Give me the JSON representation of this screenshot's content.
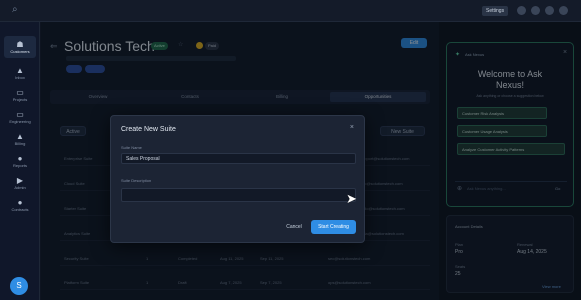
{
  "topbar": {
    "pill_label": "Settings"
  },
  "sidebar": {
    "items": [
      {
        "label": "Customers",
        "icon": "users-icon",
        "glyph": "☗"
      },
      {
        "label": "Inbox",
        "icon": "inbox-icon",
        "glyph": "▲"
      },
      {
        "label": "Projects",
        "icon": "projects-icon",
        "glyph": "▭"
      },
      {
        "label": "Engineering",
        "icon": "code-icon",
        "glyph": "▭"
      },
      {
        "label": "Billing",
        "icon": "billing-icon",
        "glyph": "▲"
      },
      {
        "label": "Reports",
        "icon": "reports-icon",
        "glyph": "●"
      },
      {
        "label": "Admin",
        "icon": "admin-icon",
        "glyph": "▶"
      },
      {
        "label": "Contracts",
        "icon": "contracts-icon",
        "glyph": "●"
      }
    ],
    "avatar_initial": "S"
  },
  "header": {
    "title": "Solutions Tech",
    "status_badge": "Active",
    "extra_badge": "Paid",
    "edit_label": "Edit"
  },
  "tabs": [
    "Overview",
    "Contacts",
    "Billing",
    "Opportunities"
  ],
  "table": {
    "filter_label": "Active",
    "new_button": "New Suite",
    "rows": [
      {
        "name": "Enterprise Suite",
        "col2": "",
        "col3": "",
        "col4": "",
        "col5": "",
        "email": "support@solutionstech.com"
      },
      {
        "name": "Cloud Suite",
        "col2": "",
        "col3": "",
        "col4": "",
        "col5": "",
        "email": "info@solutionstech.com"
      },
      {
        "name": "Starter Suite",
        "col2": "",
        "col3": "",
        "col4": "",
        "col5": "",
        "email": "hello@solutionstech.com"
      },
      {
        "name": "Analytics Suite",
        "col2": "",
        "col3": "",
        "col4": "",
        "col5": "",
        "email": "data@solutionstech.com"
      },
      {
        "name": "Security Suite",
        "col2": "1",
        "col3": "Completed",
        "col4": "Aug 11, 2025",
        "col5": "Sep 11, 2025",
        "email": "sec@solutionstech.com"
      },
      {
        "name": "Platform Suite",
        "col2": "1",
        "col3": "Draft",
        "col4": "Aug 7, 2025",
        "col5": "Sep 7, 2025",
        "email": "ops@solutionstech.com"
      }
    ]
  },
  "modal": {
    "title": "Create New Suite",
    "name_label": "Suite Name",
    "name_value": "Sales Proposal",
    "desc_label": "Suite Description",
    "desc_value": "",
    "cancel_label": "Cancel",
    "create_label": "Start Creating"
  },
  "assistant": {
    "header": "Ask Nexus",
    "welcome_line1": "Welcome to Ask",
    "welcome_line2": "Nexus!",
    "subtitle": "Ask anything or choose a suggestion below",
    "options": [
      "Customer Risk Analysis",
      "Customer Usage Analysis",
      "Analyze Customer Activity Patterns"
    ],
    "input_placeholder": "Ask Nexus anything...",
    "send_label": "Go"
  },
  "info_card": {
    "heading": "Account Details",
    "field1_label": "Plan",
    "field1_value": "Pro",
    "field2_label": "Renewal",
    "field2_value": "Aug 14, 2025",
    "field3_label": "Seats",
    "field3_value": "25",
    "footer_link": "View more"
  },
  "colors": {
    "accent": "#2f8de4",
    "success": "#2fb37a",
    "warning": "#e0b020"
  }
}
